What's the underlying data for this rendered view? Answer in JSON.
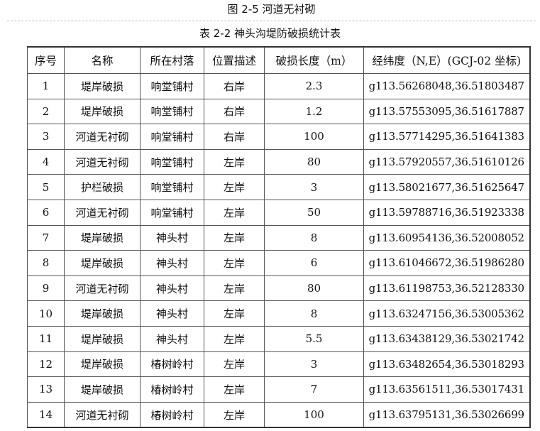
{
  "figure_caption": "图 2-5 河道无衬砌",
  "table_title": "表 2-2 神头沟堤防破损统计表",
  "columns": [
    "序号",
    "名称",
    "所在村落",
    "位置描述",
    "破损长度（m）",
    "经纬度（N,E）(GCJ-02 坐标)"
  ],
  "rows": [
    [
      "1",
      "堤岸破损",
      "响堂铺村",
      "右岸",
      "2.3",
      "g113.56268048,36.51803487"
    ],
    [
      "2",
      "堤岸破损",
      "响堂铺村",
      "右岸",
      "1.2",
      "g113.57553095,36.51617887"
    ],
    [
      "3",
      "河道无衬砌",
      "响堂铺村",
      "右岸",
      "100",
      "g113.57714295,36.51641383"
    ],
    [
      "4",
      "河道无衬砌",
      "响堂铺村",
      "左岸",
      "80",
      "g113.57920557,36.51610126"
    ],
    [
      "5",
      "护栏破损",
      "响堂铺村",
      "左岸",
      "3",
      "g113.58021677,36.51625647"
    ],
    [
      "6",
      "河道无衬砌",
      "响堂铺村",
      "左岸",
      "50",
      "g113.59788716,36.51923338"
    ],
    [
      "7",
      "堤岸破损",
      "神头村",
      "左岸",
      "8",
      "g113.60954136,36.52008052"
    ],
    [
      "8",
      "堤岸破损",
      "神头村",
      "左岸",
      "6",
      "g113.61046672,36.51986280"
    ],
    [
      "9",
      "河道无衬砌",
      "神头村",
      "左岸",
      "80",
      "g113.61198753,36.52128330"
    ],
    [
      "10",
      "堤岸破损",
      "神头村",
      "左岸",
      "8",
      "g113.63247156,36.53005362"
    ],
    [
      "11",
      "堤岸破损",
      "神头村",
      "左岸",
      "5.5",
      "g113.63438129,36.53021742"
    ],
    [
      "12",
      "堤岸破损",
      "椿树岭村",
      "左岸",
      "3",
      "g113.63482654,36.53018293"
    ],
    [
      "13",
      "堤岸破损",
      "椿树岭村",
      "左岸",
      "7",
      "g113.63561511,36.53017431"
    ],
    [
      "14",
      "河道无衬砌",
      "椿树岭村",
      "左岸",
      "100",
      "g113.63795131,36.53026699"
    ]
  ]
}
